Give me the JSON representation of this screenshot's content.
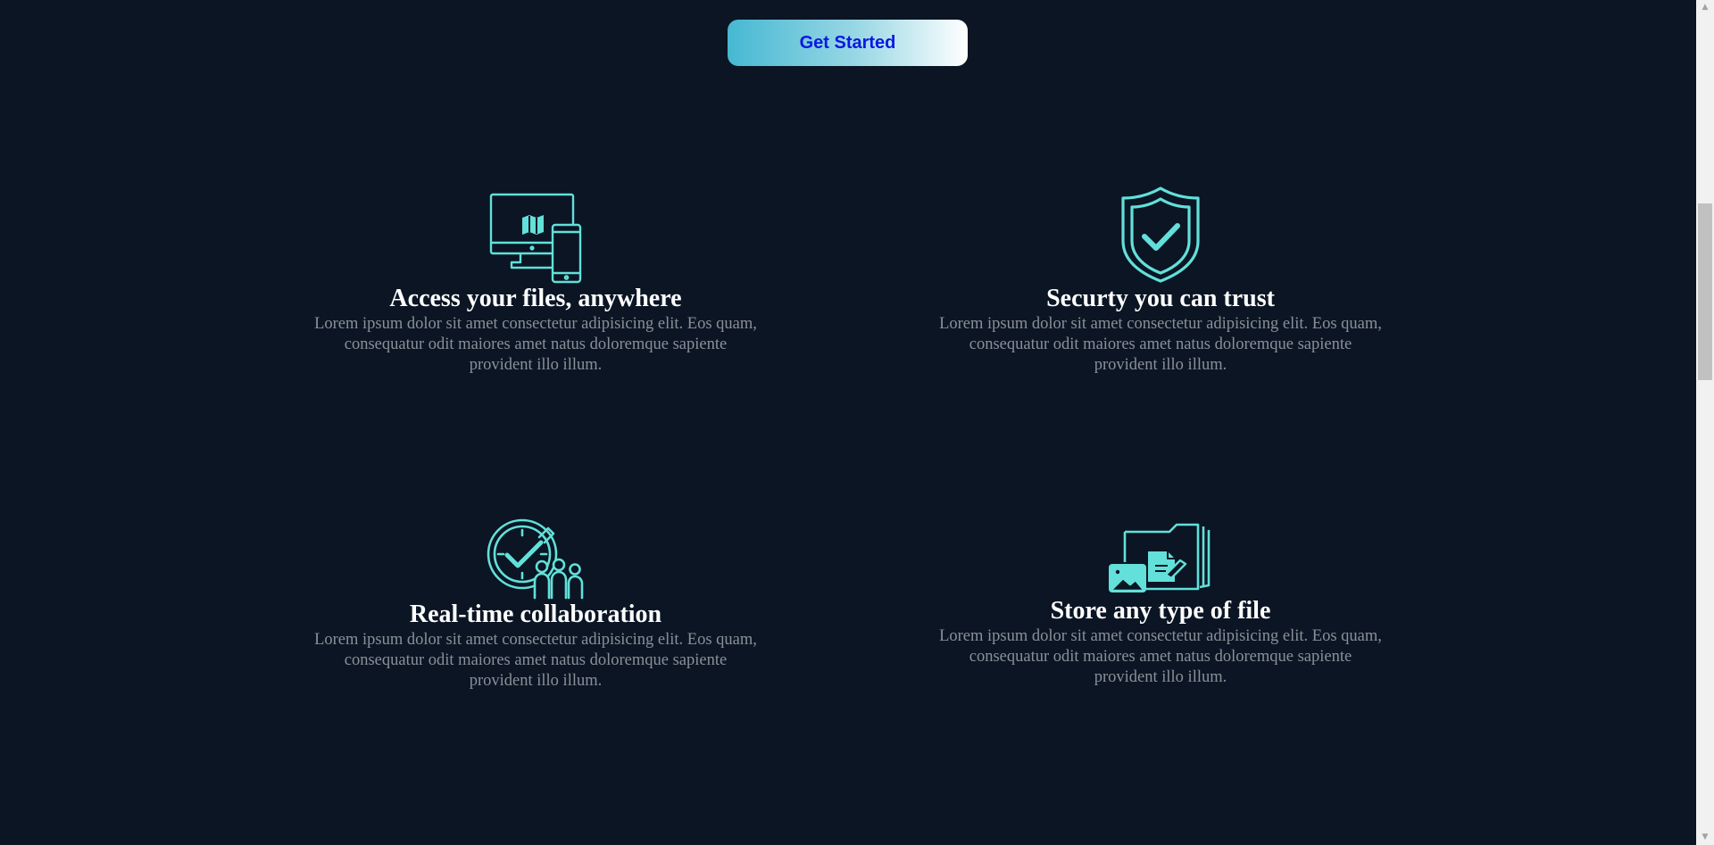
{
  "cta": {
    "label": "Get Started"
  },
  "features": [
    {
      "icon": "devices-map-icon",
      "title": "Access your files, anywhere",
      "body": "Lorem ipsum dolor sit amet consectetur adipisicing elit. Eos quam, consequatur odit maiores amet natus doloremque sapiente provident illo illum."
    },
    {
      "icon": "shield-check-icon",
      "title": "Securty you can trust",
      "body": "Lorem ipsum dolor sit amet consectetur adipisicing elit. Eos quam, consequatur odit maiores amet natus doloremque sapiente provident illo illum."
    },
    {
      "icon": "clock-team-icon",
      "title": "Real-time collaboration",
      "body": "Lorem ipsum dolor sit amet consectetur adipisicing elit. Eos quam, consequatur odit maiores amet natus doloremque sapiente provident illo illum."
    },
    {
      "icon": "folder-files-icon",
      "title": "Store any type of file",
      "body": "Lorem ipsum dolor sit amet consectetur adipisicing elit. Eos quam, consequatur odit maiores amet natus doloremque sapiente provident illo illum."
    }
  ],
  "colors": {
    "background": "#0b1524",
    "accent": "#62e0d9",
    "heading": "#ffffff",
    "body_text": "#8a9097",
    "button_text": "#0a18e0"
  },
  "scrollbar": {
    "position_fraction": 0.24
  }
}
